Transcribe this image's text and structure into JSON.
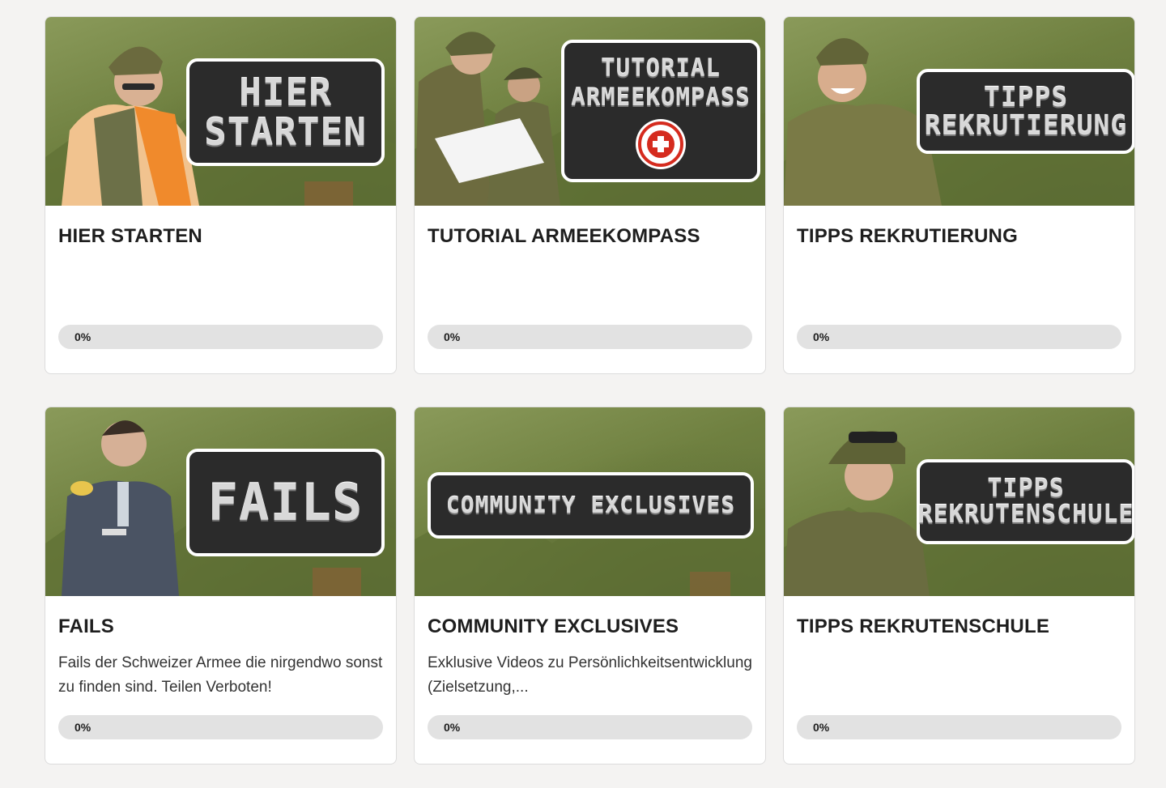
{
  "courses": [
    {
      "title": "HIER STARTEN",
      "badge_lines": [
        "HIER",
        "STARTEN"
      ],
      "description": "",
      "progress": "0%"
    },
    {
      "title": "TUTORIAL ARMEEKOMPASS",
      "badge_lines": [
        "TUTORIAL",
        "ARMEEKOMPASS"
      ],
      "description": "",
      "progress": "0%"
    },
    {
      "title": "TIPPS REKRUTIERUNG",
      "badge_lines": [
        "TIPPS",
        "REKRUTIERUNG"
      ],
      "description": "",
      "progress": "0%"
    },
    {
      "title": "FAILS",
      "badge_lines": [
        "FAILS"
      ],
      "description": "Fails der Schweizer Armee die nirgendwo sonst zu finden sind. Teilen Verboten!",
      "progress": "0%"
    },
    {
      "title": "COMMUNITY EXCLUSIVES",
      "badge_lines": [
        "COMMUNITY EXCLUSIVES"
      ],
      "description": "Exklusive Videos zu Persönlichkeitsentwicklung (Zielsetzung,...",
      "progress": "0%"
    },
    {
      "title": "TIPPS REKRUTENSCHULE",
      "badge_lines": [
        "TIPPS",
        "REKRUTENSCHULE"
      ],
      "description": "",
      "progress": "0%"
    }
  ],
  "colors": {
    "background": "#f4f3f2",
    "card": "#ffffff",
    "thumb_green": "#6f8040",
    "badge_bg": "#2b2b2b",
    "progress_track": "#e2e2e2",
    "swiss_red": "#d52b1e"
  }
}
